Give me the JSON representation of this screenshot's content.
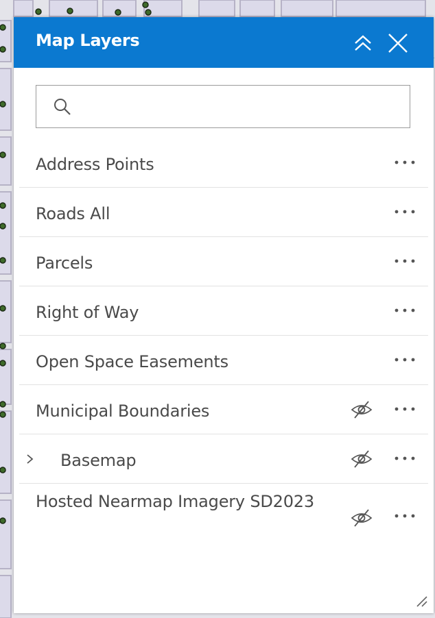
{
  "panel": {
    "title": "Map Layers",
    "header_color": "#0b79d0",
    "collapse_icon": "double-chevron-up-icon",
    "close_icon": "close-icon"
  },
  "search": {
    "value": "",
    "placeholder": "",
    "icon": "search-icon"
  },
  "layers": [
    {
      "label": "Address Points",
      "hidden": false,
      "expandable": false
    },
    {
      "label": "Roads All",
      "hidden": false,
      "expandable": false
    },
    {
      "label": "Parcels",
      "hidden": false,
      "expandable": false
    },
    {
      "label": "Right of Way",
      "hidden": false,
      "expandable": false
    },
    {
      "label": "Open Space Easements",
      "hidden": false,
      "expandable": false
    },
    {
      "label": "Municipal Boundaries",
      "hidden": true,
      "expandable": false
    },
    {
      "label": "Basemap",
      "hidden": true,
      "expandable": true
    },
    {
      "label": "Hosted Nearmap Imagery SD2023",
      "hidden": true,
      "expandable": false
    }
  ]
}
